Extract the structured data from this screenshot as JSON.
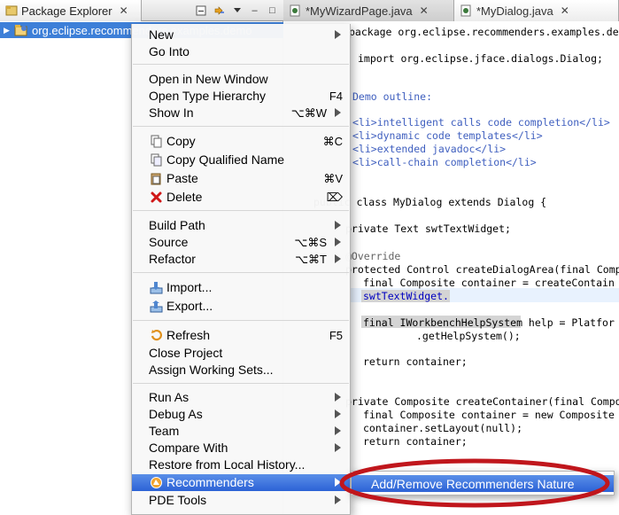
{
  "package_explorer": {
    "tab_title": "Package Explorer",
    "close_glyph": "✕",
    "toolbar": {
      "collapse_icon": "collapse-all-icon",
      "link_icon": "link-with-editor-icon",
      "menu_icon": "view-menu-icon",
      "minimize_glyph": "–",
      "maximize_glyph": "□"
    },
    "tree": {
      "project_label": "org.eclipse.recommenders.examples.demo"
    }
  },
  "editor": {
    "tabs": [
      {
        "label": "*MyWizardPage.java",
        "close_glyph": "✕"
      },
      {
        "label": "*MyDialog.java",
        "close_glyph": "✕"
      }
    ],
    "code_lines": [
      "package org.eclipse.recommenders.examples.demo;",
      "import org.eclipse.jface.dialogs.Dialog;",
      "Demo outline:",
      "<li>intelligent calls code completion</li>",
      "<li>dynamic code templates</li>",
      "<li>extended javadoc</li>",
      "<li>call-chain completion</li>",
      "public class MyDialog extends Dialog {",
      "private Text swtTextWidget;",
      "@Override",
      "protected Control createDialogArea(final Compo",
      "final Composite container = createContain",
      "swtTextWidget.",
      "final IWorkbenchHelpSystem help = Platfor",
      ".getHelpSystem();",
      "return container;",
      "private Composite createContainer(final Compo",
      "final Composite container = new Composite",
      "container.setLayout(null);",
      "return container;"
    ]
  },
  "context_menu": {
    "items": [
      {
        "label": "New",
        "submenu": true
      },
      {
        "label": "Go Into"
      },
      {
        "label": "Open in New Window"
      },
      {
        "label": "Open Type Hierarchy",
        "shortcut": "F4"
      },
      {
        "label": "Show In",
        "shortcut": "⌥⌘W",
        "submenu": true
      },
      {
        "label": "Copy",
        "shortcut": "⌘C",
        "icon": "copy-icon"
      },
      {
        "label": "Copy Qualified Name",
        "icon": "copy-qualified-name-icon"
      },
      {
        "label": "Paste",
        "shortcut": "⌘V",
        "icon": "paste-icon"
      },
      {
        "label": "Delete",
        "shortcut": "⌦",
        "icon": "delete-icon"
      },
      {
        "label": "Build Path",
        "submenu": true
      },
      {
        "label": "Source",
        "shortcut": "⌥⌘S",
        "submenu": true
      },
      {
        "label": "Refactor",
        "shortcut": "⌥⌘T",
        "submenu": true
      },
      {
        "label": "Import...",
        "icon": "import-icon"
      },
      {
        "label": "Export...",
        "icon": "export-icon"
      },
      {
        "label": "Refresh",
        "shortcut": "F5",
        "icon": "refresh-icon"
      },
      {
        "label": "Close Project"
      },
      {
        "label": "Assign Working Sets..."
      },
      {
        "label": "Run As",
        "submenu": true
      },
      {
        "label": "Debug As",
        "submenu": true
      },
      {
        "label": "Team",
        "submenu": true
      },
      {
        "label": "Compare With",
        "submenu": true
      },
      {
        "label": "Restore from Local History..."
      },
      {
        "label": "Recommenders",
        "submenu": true,
        "icon": "recommenders-icon",
        "selected": true
      },
      {
        "label": "PDE Tools",
        "submenu": true
      }
    ]
  },
  "submenu": {
    "item_label": "Add/Remove Recommenders Nature"
  },
  "colors": {
    "selection_blue": "#2c62d6",
    "highlight_red": "#c0161c",
    "keyword": "#7f0055",
    "comment": "#3f5fbf"
  }
}
